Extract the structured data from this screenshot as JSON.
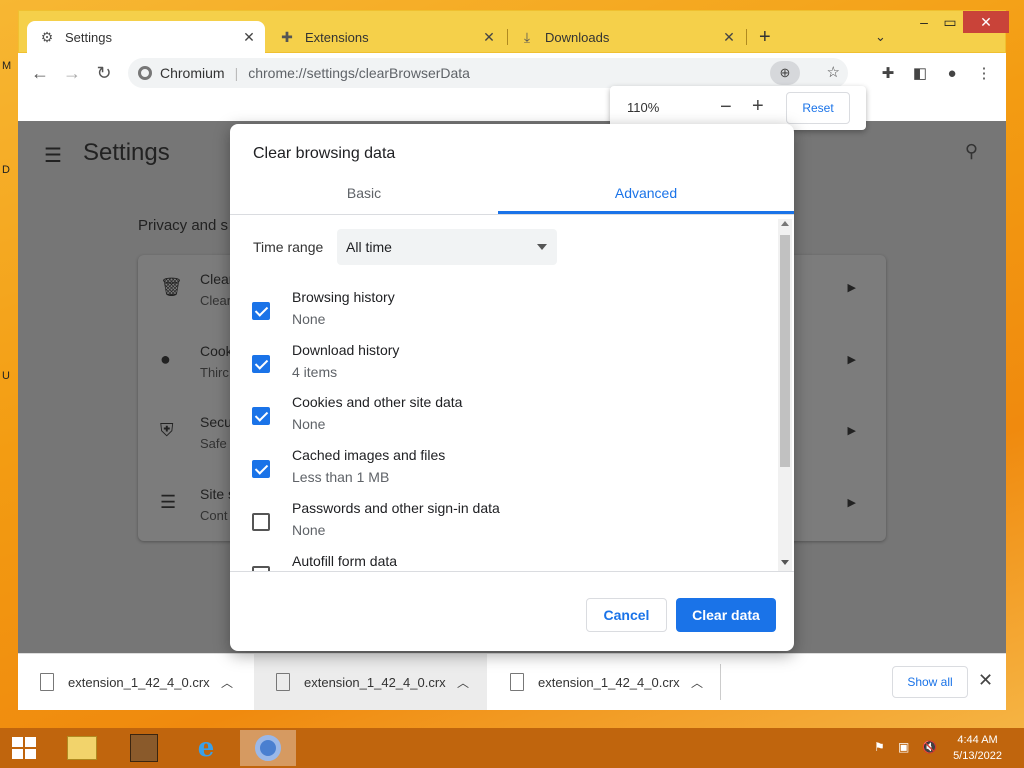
{
  "desktop": {
    "side_letters": [
      "M",
      "D",
      "U"
    ]
  },
  "tabs": [
    {
      "label": "Settings",
      "icon": "gear-icon"
    },
    {
      "label": "Extensions",
      "icon": "puzzle-icon"
    },
    {
      "label": "Downloads",
      "icon": "download-icon"
    }
  ],
  "toolbar": {
    "site": "Chromium",
    "url": "chrome://settings/clearBrowserData"
  },
  "zoom": {
    "percent": "110%",
    "reset_label": "Reset"
  },
  "page": {
    "title": "Settings",
    "section": "Privacy and s",
    "rows": [
      {
        "t1": "Clear",
        "t2": "Clear",
        "icon": "trash-icon"
      },
      {
        "t1": "Cook",
        "t2": "Thirc",
        "icon": "cookie-icon"
      },
      {
        "t1": "Secu",
        "t2": "Safe",
        "icon": "shield-icon"
      },
      {
        "t1": "Site s",
        "t2": "Cont",
        "icon": "sliders-icon"
      }
    ]
  },
  "dialog": {
    "title": "Clear browsing data",
    "tab_basic": "Basic",
    "tab_advanced": "Advanced",
    "time_range_label": "Time range",
    "time_range_value": "All time",
    "options": [
      {
        "label": "Browsing history",
        "detail": "None",
        "checked": true
      },
      {
        "label": "Download history",
        "detail": "4 items",
        "checked": true
      },
      {
        "label": "Cookies and other site data",
        "detail": "None",
        "checked": true
      },
      {
        "label": "Cached images and files",
        "detail": "Less than 1 MB",
        "checked": true
      },
      {
        "label": "Passwords and other sign-in data",
        "detail": "None",
        "checked": false
      },
      {
        "label": "Autofill form data",
        "detail": "",
        "checked": false
      }
    ],
    "cancel_label": "Cancel",
    "clear_label": "Clear data"
  },
  "downloads": {
    "items": [
      {
        "name": "extension_1_42_4_0.crx"
      },
      {
        "name": "extension_1_42_4_0.crx"
      },
      {
        "name": "extension_1_42_4_0.crx"
      }
    ],
    "show_all": "Show all"
  },
  "taskbar": {
    "time": "4:44 AM",
    "date": "5/13/2022"
  }
}
